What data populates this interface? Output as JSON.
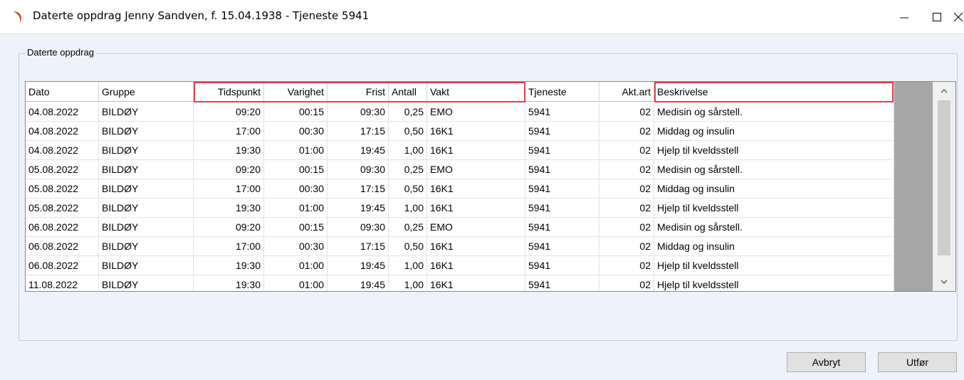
{
  "window": {
    "title": "Daterte oppdrag Jenny Sandven,  f. 15.04.1938 - Tjeneste 5941",
    "accent_color": "#d93025"
  },
  "group": {
    "label": "Daterte oppdrag"
  },
  "table": {
    "columns": [
      "Dato",
      "Gruppe",
      "Tidspunkt",
      "Varighet",
      "Frist",
      "Antall",
      "Vakt",
      "Tjeneste",
      "Akt.art",
      "Beskrivelse"
    ],
    "rows": [
      [
        "04.08.2022",
        "BILDØY",
        "09:20",
        "00:15",
        "09:30",
        "0,25",
        "EMO",
        "5941",
        "02",
        "Medisin og sårstell."
      ],
      [
        "04.08.2022",
        "BILDØY",
        "17:00",
        "00:30",
        "17:15",
        "0,50",
        "16K1",
        "5941",
        "02",
        "Middag og insulin"
      ],
      [
        "04.08.2022",
        "BILDØY",
        "19:30",
        "01:00",
        "19:45",
        "1,00",
        "16K1",
        "5941",
        "02",
        "Hjelp til kveldsstell"
      ],
      [
        "05.08.2022",
        "BILDØY",
        "09:20",
        "00:15",
        "09:30",
        "0,25",
        "EMO",
        "5941",
        "02",
        "Medisin og sårstell."
      ],
      [
        "05.08.2022",
        "BILDØY",
        "17:00",
        "00:30",
        "17:15",
        "0,50",
        "16K1",
        "5941",
        "02",
        "Middag og insulin"
      ],
      [
        "05.08.2022",
        "BILDØY",
        "19:30",
        "01:00",
        "19:45",
        "1,00",
        "16K1",
        "5941",
        "02",
        "Hjelp til kveldsstell"
      ],
      [
        "06.08.2022",
        "BILDØY",
        "09:20",
        "00:15",
        "09:30",
        "0,25",
        "EMO",
        "5941",
        "02",
        "Medisin og sårstell."
      ],
      [
        "06.08.2022",
        "BILDØY",
        "17:00",
        "00:30",
        "17:15",
        "0,50",
        "16K1",
        "5941",
        "02",
        "Middag og insulin"
      ],
      [
        "06.08.2022",
        "BILDØY",
        "19:30",
        "01:00",
        "19:45",
        "1,00",
        "16K1",
        "5941",
        "02",
        "Hjelp til kveldsstell"
      ],
      [
        "11.08.2022",
        "BILDØY",
        "19:30",
        "01:00",
        "19:45",
        "1,00",
        "16K1",
        "5941",
        "02",
        "Hjelp til kveldsstell"
      ]
    ],
    "highlight_color": "#e0414d"
  },
  "buttons": {
    "cancel": "Avbryt",
    "execute": "Utfør"
  },
  "icons": {
    "app": "app-logo-icon",
    "minimize": "minimize-icon",
    "maximize": "maximize-icon",
    "close": "close-icon",
    "scroll_up": "chevron-up-icon",
    "scroll_down": "chevron-down-icon"
  }
}
